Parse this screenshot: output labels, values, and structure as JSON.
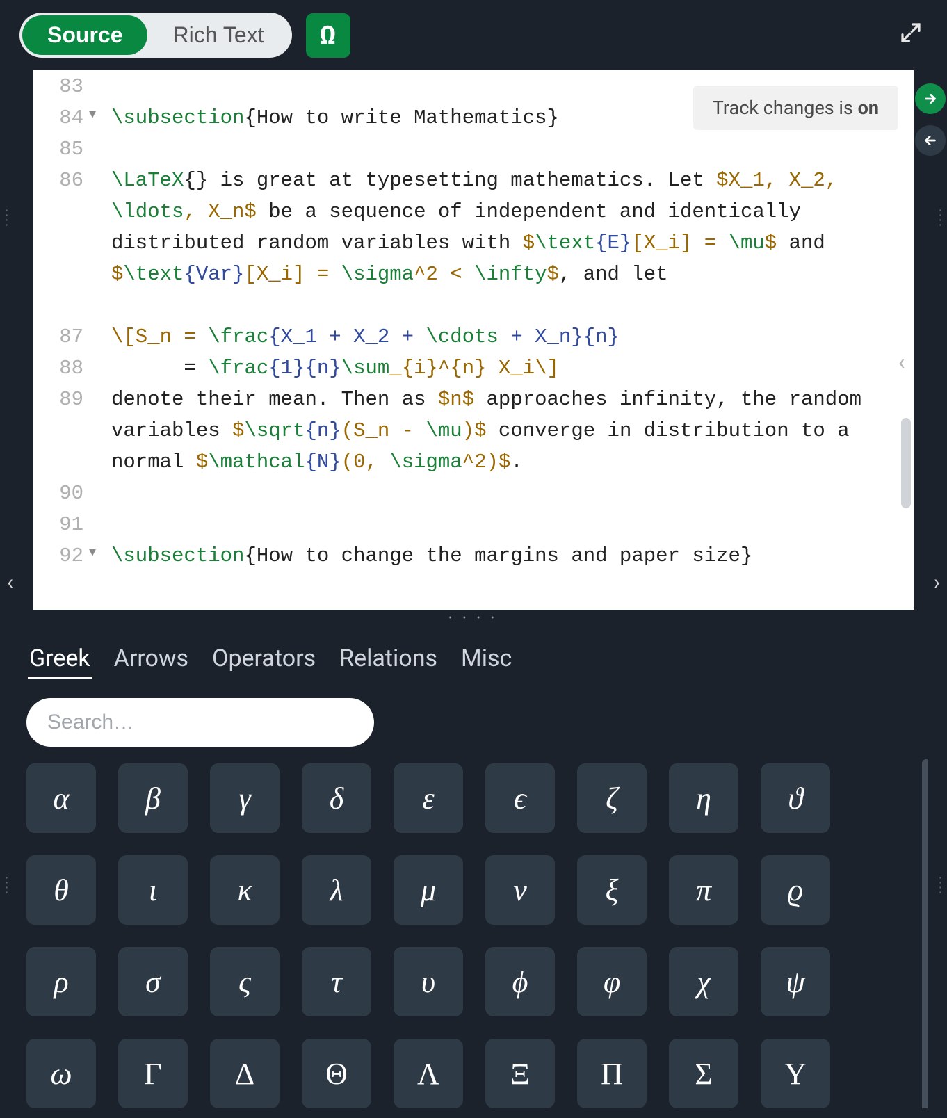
{
  "toolbar": {
    "source_tab": "Source",
    "rich_tab": "Rich Text",
    "omega": "Ω"
  },
  "track_changes": {
    "prefix": "Track changes is ",
    "state": "on"
  },
  "editor": {
    "lines": [
      {
        "n": "83",
        "fold": false,
        "parts": []
      },
      {
        "n": "84",
        "fold": true,
        "parts": [
          {
            "t": "\\subsection",
            "c": "cmd"
          },
          {
            "t": "{",
            "c": "punct"
          },
          {
            "t": "How to write Mathematics",
            "c": ""
          },
          {
            "t": "}",
            "c": "punct"
          }
        ]
      },
      {
        "n": "85",
        "fold": false,
        "parts": []
      },
      {
        "n": "86",
        "fold": false,
        "tall": 5,
        "parts": [
          {
            "t": "\\LaTeX",
            "c": "cmd"
          },
          {
            "t": "{} is great at typesetting mathematics. Let ",
            "c": ""
          },
          {
            "t": "$X_1, X_2, ",
            "c": "math"
          },
          {
            "t": "\\ldots",
            "c": "cmd"
          },
          {
            "t": ", X_n$",
            "c": "math"
          },
          {
            "t": " be a sequence of independent and identically distributed random variables with ",
            "c": ""
          },
          {
            "t": "$",
            "c": "math"
          },
          {
            "t": "\\text",
            "c": "cmd"
          },
          {
            "t": "{E}",
            "c": "arg"
          },
          {
            "t": "[X_i] = ",
            "c": "math"
          },
          {
            "t": "\\mu",
            "c": "cmd"
          },
          {
            "t": "$",
            "c": "math"
          },
          {
            "t": " and ",
            "c": ""
          },
          {
            "t": "$",
            "c": "math"
          },
          {
            "t": "\\text",
            "c": "cmd"
          },
          {
            "t": "{Var}",
            "c": "arg"
          },
          {
            "t": "[X_i] = ",
            "c": "math"
          },
          {
            "t": "\\sigma",
            "c": "cmd"
          },
          {
            "t": "^2 < ",
            "c": "math"
          },
          {
            "t": "\\infty",
            "c": "cmd"
          },
          {
            "t": "$",
            "c": "math"
          },
          {
            "t": ", and let",
            "c": ""
          }
        ]
      },
      {
        "n": "87",
        "fold": false,
        "parts": [
          {
            "t": "\\[S_n = ",
            "c": "math"
          },
          {
            "t": "\\frac",
            "c": "cmd"
          },
          {
            "t": "{X_1 + X_2 + ",
            "c": "arg"
          },
          {
            "t": "\\cdots",
            "c": "cmd"
          },
          {
            "t": " + X_n}{n}",
            "c": "arg"
          }
        ]
      },
      {
        "n": "88",
        "fold": false,
        "parts": [
          {
            "t": "      = ",
            "c": ""
          },
          {
            "t": "\\frac",
            "c": "cmd"
          },
          {
            "t": "{1}{n}",
            "c": "arg"
          },
          {
            "t": "\\sum",
            "c": "cmd"
          },
          {
            "t": "_{i}^{n} X_i",
            "c": "math"
          },
          {
            "t": "\\]",
            "c": "math"
          }
        ]
      },
      {
        "n": "89",
        "fold": false,
        "tall": 3,
        "parts": [
          {
            "t": "denote their mean. Then as ",
            "c": ""
          },
          {
            "t": "$n$",
            "c": "math"
          },
          {
            "t": " approaches infinity, the random variables ",
            "c": ""
          },
          {
            "t": "$",
            "c": "math"
          },
          {
            "t": "\\sqrt",
            "c": "cmd"
          },
          {
            "t": "{n}",
            "c": "arg"
          },
          {
            "t": "(S_n - ",
            "c": "math"
          },
          {
            "t": "\\mu",
            "c": "cmd"
          },
          {
            "t": ")$",
            "c": "math"
          },
          {
            "t": " converge in distribution to a normal ",
            "c": ""
          },
          {
            "t": "$",
            "c": "math"
          },
          {
            "t": "\\mathcal",
            "c": "cmd"
          },
          {
            "t": "{N}",
            "c": "arg"
          },
          {
            "t": "(0, ",
            "c": "math"
          },
          {
            "t": "\\sigma",
            "c": "cmd"
          },
          {
            "t": "^2)$",
            "c": "math"
          },
          {
            "t": ".",
            "c": ""
          }
        ]
      },
      {
        "n": "90",
        "fold": false,
        "parts": []
      },
      {
        "n": "91",
        "fold": false,
        "parts": []
      },
      {
        "n": "92",
        "fold": true,
        "parts": [
          {
            "t": "\\subsection",
            "c": "cmd"
          },
          {
            "t": "{",
            "c": "punct"
          },
          {
            "t": "How to change the margins and paper size",
            "c": ""
          },
          {
            "t": "}",
            "c": "punct"
          }
        ]
      }
    ]
  },
  "symbol_panel": {
    "categories": [
      "Greek",
      "Arrows",
      "Operators",
      "Relations",
      "Misc"
    ],
    "active_category": "Greek",
    "search_placeholder": "Search…",
    "symbols": [
      "α",
      "β",
      "γ",
      "δ",
      "ε",
      "ϵ",
      "ζ",
      "η",
      "ϑ",
      "θ",
      "ι",
      "κ",
      "λ",
      "μ",
      "ν",
      "ξ",
      "π",
      "ϱ",
      "ρ",
      "σ",
      "ς",
      "τ",
      "υ",
      "ϕ",
      "φ",
      "χ",
      "ψ",
      "ω",
      "Γ",
      "Δ",
      "Θ",
      "Λ",
      "Ξ",
      "Π",
      "Σ",
      "Υ"
    ],
    "upright_indices": [
      28,
      29,
      30,
      31,
      32,
      33,
      34,
      35
    ]
  }
}
